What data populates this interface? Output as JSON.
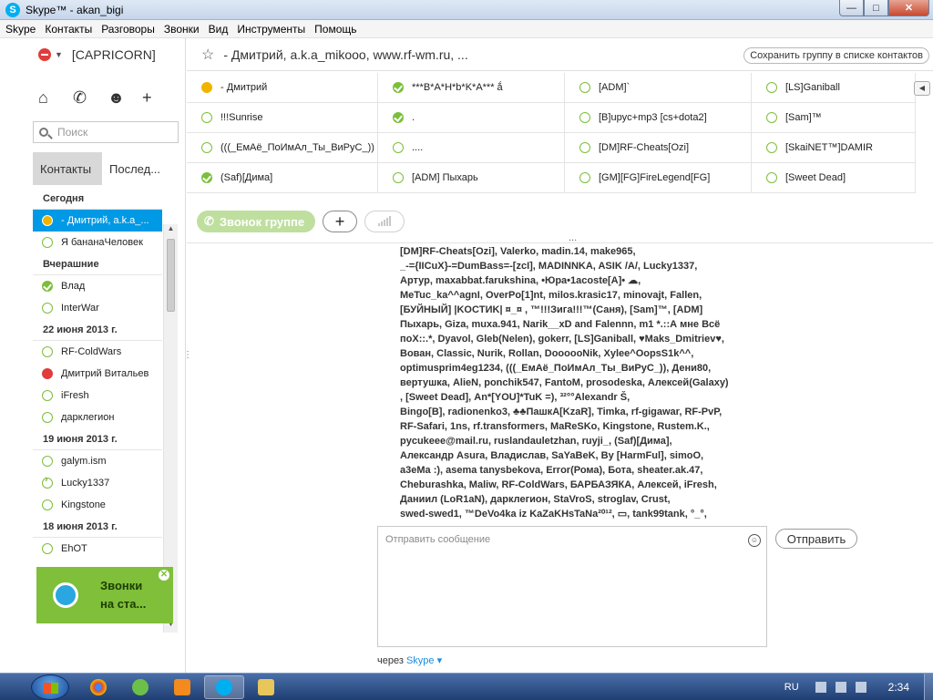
{
  "window": {
    "title": "Skype™ - akan_bigi",
    "app_icon": "S",
    "min": "—",
    "max": "□",
    "close": "✕"
  },
  "menu": [
    "Skype",
    "Контакты",
    "Разговоры",
    "Звонки",
    "Вид",
    "Инструменты",
    "Помощь"
  ],
  "profile": {
    "name": "[CAPRICORN]",
    "status": "do-not-disturb"
  },
  "sidebar_icons": [
    "home-icon",
    "phone-icon",
    "group-icon",
    "add-contact-icon"
  ],
  "search": {
    "placeholder": "Поиск"
  },
  "tabs": {
    "contacts": "Контакты",
    "recent": "Послед..."
  },
  "recent_list": [
    {
      "type": "header",
      "text": "Сегодня"
    },
    {
      "type": "contact",
      "name": "- Дмитрий, a.k.a_...",
      "status": "yellow",
      "selected": true
    },
    {
      "type": "contact",
      "name": "Я бананаЧеловек",
      "status": "offline"
    },
    {
      "type": "header",
      "text": "Вчерашние"
    },
    {
      "type": "contact",
      "name": "Влад",
      "status": "online"
    },
    {
      "type": "contact",
      "name": "InterWar",
      "status": "offline"
    },
    {
      "type": "header",
      "text": "22 июня 2013 г."
    },
    {
      "type": "contact",
      "name": "RF-ColdWars",
      "status": "offline"
    },
    {
      "type": "contact",
      "name": "Дмитрий Витальев",
      "status": "dnd"
    },
    {
      "type": "contact",
      "name": "iFresh",
      "status": "offline"
    },
    {
      "type": "contact",
      "name": "дарклегион",
      "status": "offline"
    },
    {
      "type": "header",
      "text": "19 июня 2013 г."
    },
    {
      "type": "contact",
      "name": "galym.ism",
      "status": "offline"
    },
    {
      "type": "contact",
      "name": "Lucky1337",
      "status": "forward"
    },
    {
      "type": "contact",
      "name": "Kingstone",
      "status": "offline"
    },
    {
      "type": "header",
      "text": "18 июня 2013 г."
    },
    {
      "type": "contact",
      "name": "EhOT",
      "status": "offline"
    }
  ],
  "promo": {
    "line1": "Звонки",
    "line2": "на ста..."
  },
  "conversation": {
    "title": "- Дмитрий, a.k.a_mikooo, www.rf-wm.ru, ...",
    "save_group": "Сохранить группу в списке контактов"
  },
  "participants": [
    [
      {
        "name": "- Дмитрий",
        "status": "yellow"
      },
      {
        "name": "***B*A*H*b*K*A*** ắ",
        "status": "online"
      },
      {
        "name": "[ADM]`",
        "status": "offline"
      },
      {
        "name": "[LS]Ganiball",
        "status": "offline"
      }
    ],
    [
      {
        "name": "!!!Sunrise",
        "status": "offline"
      },
      {
        "name": ".",
        "status": "online"
      },
      {
        "name": "[B]upyc+mp3 [cs+dota2]",
        "status": "offline"
      },
      {
        "name": "[Sam]™",
        "status": "offline"
      }
    ],
    [
      {
        "name": "(((_ЕмАё_ПоИмАл_Ты_ВиРуС_))",
        "status": "offline"
      },
      {
        "name": "....",
        "status": "offline"
      },
      {
        "name": "[DM]RF-Cheats[Ozi]",
        "status": "offline"
      },
      {
        "name": "[SkaiNET™]DAMIR",
        "status": "offline"
      }
    ],
    [
      {
        "name": "(Saf)[Дима]",
        "status": "online"
      },
      {
        "name": "[ADM] Пыхарь",
        "status": "offline"
      },
      {
        "name": "[GM][FG]FireLegend[FG]",
        "status": "offline"
      },
      {
        "name": "[Sweet Dead]",
        "status": "offline"
      }
    ]
  ],
  "grid_nav": "◀",
  "call": {
    "label": "Звонок группе",
    "add": "+"
  },
  "dots": "...",
  "message_text": "[DM]RF-Cheats[Ozi], Valerko, madin.14, make965,\n_-={IICuX}-=DumBass=-[zcI], MADINNKA, ASIK /A/, Lucky1337,\nАртур, maxabbat.farukshina, •Юра•1acoste[A]• ☁,\nMeTuc_ka^^agnI, OverPo[1]nt, milos.krasic17, minovajt, Fallen,\n[БУЙНЫЙ] |KOCTИK| ¤_¤ , ™!!!Зига!!!™(Саня), [Sam]™, [ADM]\nПыхарь, Giza, muxa.941, Narik__xD and Falennn, m1 *.::А мне Всё\nпоХ::.*, Dyavol, Gleb(Nelen), gokerr, [LS]Ganiball, ♥Maks_Dmitriev♥,\nВован, Classic, Nurik, Rollan, DoooooNik, Xylee^OopsS1k^^,\noptimusprim4eg1234, (((_ЕмАё_ПоИмАл_Ты_ВиРуС_)), Дени80,\nвертушка, AlieN, ponchik547, FantoM, prosodeska, Алексей(Galaxy)\n, [Sweet Dead], An*[YOU]*TuK =), ³²°°Alexandr Š,\nBingo[B], radionenko3, ♣♣ПашкА[KzaR], Timka, rf-gigawar, RF-PvP,\nRF-Safari, 1ns, rf.transformers, MaReSKo, Kingstone, Rustem.K.,\npycukeee@mail.ru, ruslandauletzhan, ruyji_, (Saf)[Дима],\nАлександр Asura, Владислав, SaYaBeK, By [HarmFul], simoO,\na3eMa :), asema tanysbekova, Error(Рома), Бота, sheater.ak.47,\nCheburashka, Maliw, RF-ColdWars, БАРБАЗЯКА, Алексей, iFresh,\nДаниил (LoR1aN), дарклегион, StaVroS, stroglav, Crust,\nswed-swed1, ™DeVo4ka iz KaZaKHsTaNa²⁰¹², ▭, tank99tank, °_°,",
  "compose": {
    "placeholder": "Отправить сообщение",
    "send": "Отправить"
  },
  "via": {
    "prefix": "через",
    "brand": "Skype ▾"
  },
  "taskbar": {
    "lang": "RU",
    "time": "2:34"
  },
  "colors": {
    "skype_blue": "#00aff0",
    "online_green": "#7bbf3a",
    "selected_blue": "#0099e5",
    "dnd_red": "#e03c3c"
  }
}
